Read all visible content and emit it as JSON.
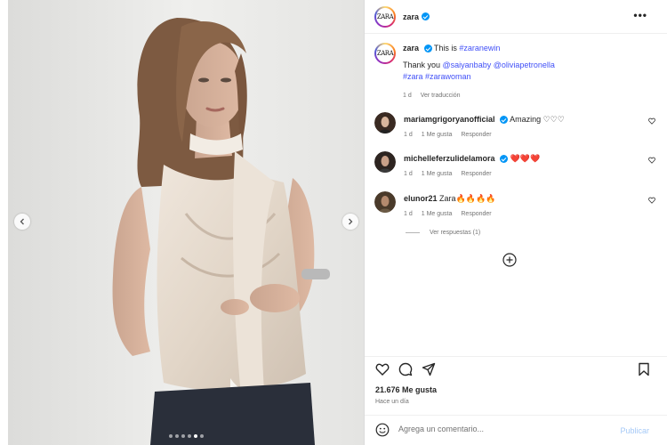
{
  "post": {
    "author": "zara",
    "logo_text": "ZARA",
    "caption_line1_prefix": "This is ",
    "caption_hashtag": "#zaranewin",
    "caption_line2_prefix": "Thank you ",
    "caption_mention1": "@saiyanbaby",
    "caption_mention2": "@oliviapetronella",
    "caption_tag1": "#zara",
    "caption_tag2": "#zarawoman",
    "age": "1 d",
    "translate_label": "Ver traducción",
    "more_label": "•••"
  },
  "media": {
    "slide_count": 6,
    "active_slide": 4
  },
  "comments": [
    {
      "user": "mariamgrigoryanofficial",
      "verified": true,
      "text": "Amazing ♡♡♡",
      "age": "1 d",
      "likes": "1 Me gusta",
      "reply": "Responder"
    },
    {
      "user": "michelleferzulidelamora",
      "verified": true,
      "text": "",
      "hearts": "❤️❤️❤️",
      "age": "1 d",
      "likes": "1 Me gusta",
      "reply": "Responder"
    },
    {
      "user": "elunor21",
      "verified": false,
      "text": "Zara🔥🔥🔥🔥",
      "age": "1 d",
      "likes": "1 Me gusta",
      "reply": "Responder"
    }
  ],
  "replies_label": "Ver respuestas (1)",
  "stats": {
    "likes": "21.676 Me gusta",
    "time": "Hace un día"
  },
  "composer": {
    "placeholder": "Agrega un comentario...",
    "publish_label": "Publicar"
  },
  "colors": {
    "link": "#4150f7",
    "verified": "#0095f6",
    "publish": "#a5c9f7"
  }
}
